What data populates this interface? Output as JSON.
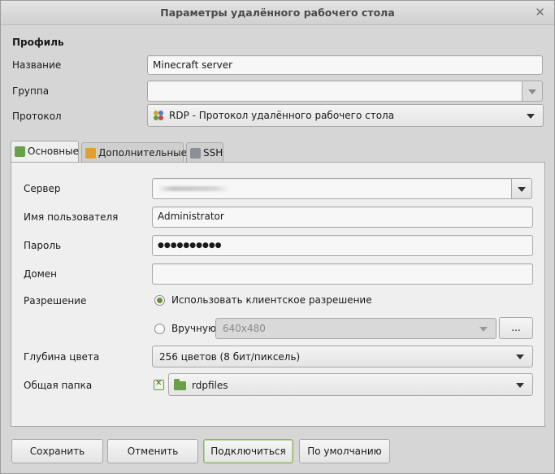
{
  "window": {
    "title": "Параметры удалённого рабочего стола"
  },
  "profile": {
    "heading": "Профиль",
    "name_label": "Название",
    "name_value": "Minecraft server",
    "group_label": "Группа",
    "group_value": "",
    "protocol_label": "Протокол",
    "protocol_value": "RDP - Протокол удалённого рабочего стола"
  },
  "tabs": [
    {
      "label": "Основные"
    },
    {
      "label": "Дополнительные"
    },
    {
      "label": "SSH"
    }
  ],
  "basic": {
    "server_label": "Сервер",
    "user_label": "Имя пользователя",
    "user_value": "Administrator",
    "password_label": "Пароль",
    "password_value": "●●●●●●●●●●",
    "domain_label": "Домен",
    "domain_value": "",
    "resolution_label": "Разрешение",
    "resolution_client": "Использовать клиентское разрешение",
    "resolution_manual": "Вручную",
    "resolution_manual_value": "640x480",
    "resolution_more": "...",
    "depth_label": "Глубина цвета",
    "depth_value": "256 цветов (8 бит/пиксель)",
    "share_label": "Общая папка",
    "share_value": "rdpfiles"
  },
  "buttons": {
    "save": "Сохранить",
    "cancel": "Отменить",
    "connect": "Подключиться",
    "default": "По умолчанию"
  },
  "colors": {
    "accent": "#6a8f3a"
  }
}
